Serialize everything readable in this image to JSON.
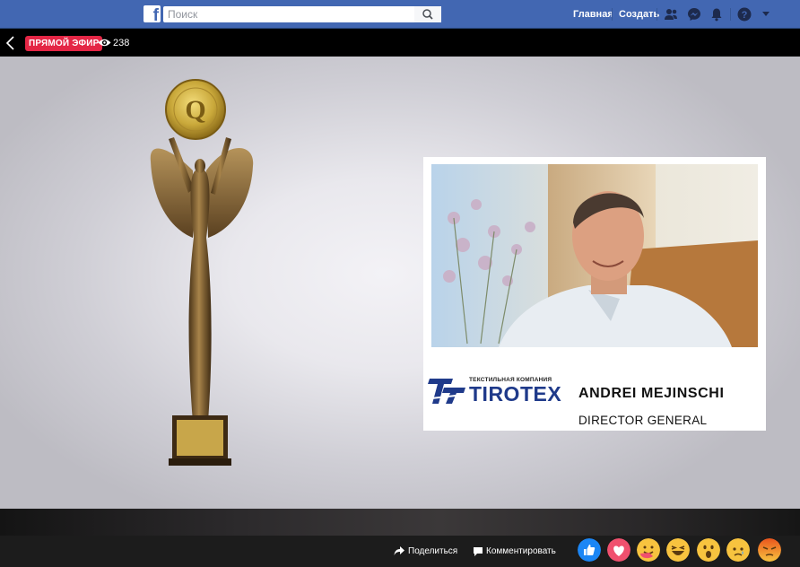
{
  "topbar": {
    "logo_letter": "f",
    "search_placeholder": "Поиск",
    "home_label": "Главная",
    "create_label": "Создать",
    "icons": [
      "friends-icon",
      "messenger-icon",
      "notifications-icon",
      "help-icon",
      "menu-caret-icon"
    ]
  },
  "live": {
    "badge": "ПРЯМОЙ ЭФИР",
    "viewers": "238"
  },
  "lower_third": {
    "company_small": "ТЕКСТИЛЬНАЯ КОМПАНИЯ",
    "company_name": "TIROTEX",
    "person_name": "ANDREI MEJINSCHI",
    "person_role": "DIRECTOR GENERAL"
  },
  "actions": {
    "share": "Поделиться",
    "comment": "Комментировать"
  },
  "reactions": [
    "like",
    "love",
    "care",
    "haha",
    "wow",
    "sad",
    "angry"
  ],
  "colors": {
    "facebook_blue": "#4267b2",
    "live_red": "#e42645",
    "tirotex_blue": "#1f3a8a"
  }
}
